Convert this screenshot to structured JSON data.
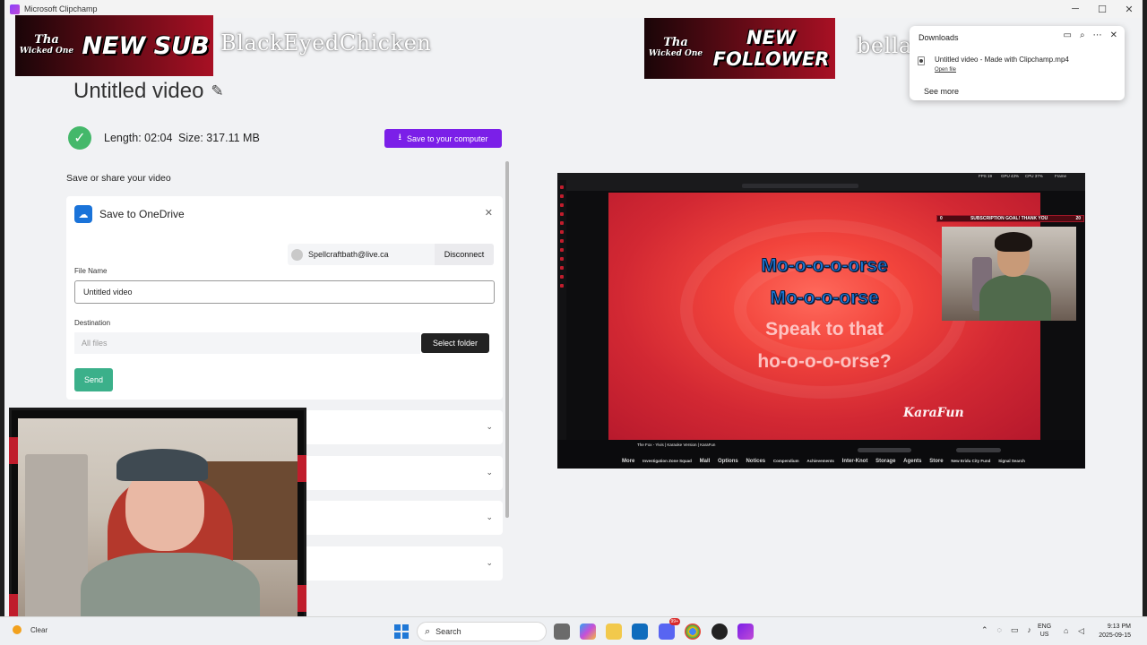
{
  "window": {
    "title": "Microsoft Clipchamp",
    "controls": [
      "─",
      "☐",
      "✕"
    ]
  },
  "overlays": {
    "sub_banner": {
      "logo_line1": "Tha",
      "logo_line2": "Wicked One",
      "text": "NEW SUB"
    },
    "sub_name": "BlackEyedChicken",
    "follower_banner": {
      "logo_line1": "Tha",
      "logo_line2": "Wicked One",
      "text": "NEW FOLLOWER"
    },
    "follower_name": "bella_parra110"
  },
  "export": {
    "title": "Untitled video",
    "length": "Length: 02:04",
    "size": "Size: 317.11 MB",
    "save_button": "Save to your computer",
    "section_label": "Save or share your video",
    "onedrive": {
      "title": "Save to OneDrive",
      "account": "Spellcraftbath@live.ca",
      "disconnect": "Disconnect",
      "file_name_label": "File Name",
      "file_name_value": "Untitled video",
      "destination_label": "Destination",
      "destination_placeholder": "All files",
      "select_folder": "Select folder",
      "send": "Send"
    }
  },
  "preview": {
    "lyrics": [
      "Mo-o-o-o-orse",
      "Mo-o-o-orse",
      "Speak to that",
      "ho-o-o-o-orse?"
    ],
    "karafun_logo": "KaraFun",
    "sub_goal_count": "0",
    "sub_goal_label": "SUBSCRIPTION GOAL! THANK YOU",
    "sub_goal_target": "20",
    "video_title": "The Fox - Yivis | Karaoke Version | KaraFun",
    "nav": [
      "More",
      "Investigation Zone Squad",
      "Mall",
      "Options",
      "Notices",
      "Compendium",
      "Achievements",
      "Inter-Knot",
      "Storage",
      "Agents",
      "Store",
      "New Eridu City Fund",
      "Signal Search"
    ],
    "stats": {
      "fps": "FPS  19",
      "gpu": "GPU  43%",
      "cpu": "CPU  37%",
      "fps_label": "Frame"
    }
  },
  "downloads": {
    "title": "Downloads",
    "filename": "Untitled video - Made with Clipchamp.mp4",
    "open_file": "Open file",
    "see_more": "See more"
  },
  "taskbar": {
    "weather": "Clear",
    "search_placeholder": "Search",
    "discord_badge": "99+",
    "lang_top": "ENG",
    "lang_bottom": "US",
    "time": "9:13 PM",
    "date": "2025-09-15"
  }
}
